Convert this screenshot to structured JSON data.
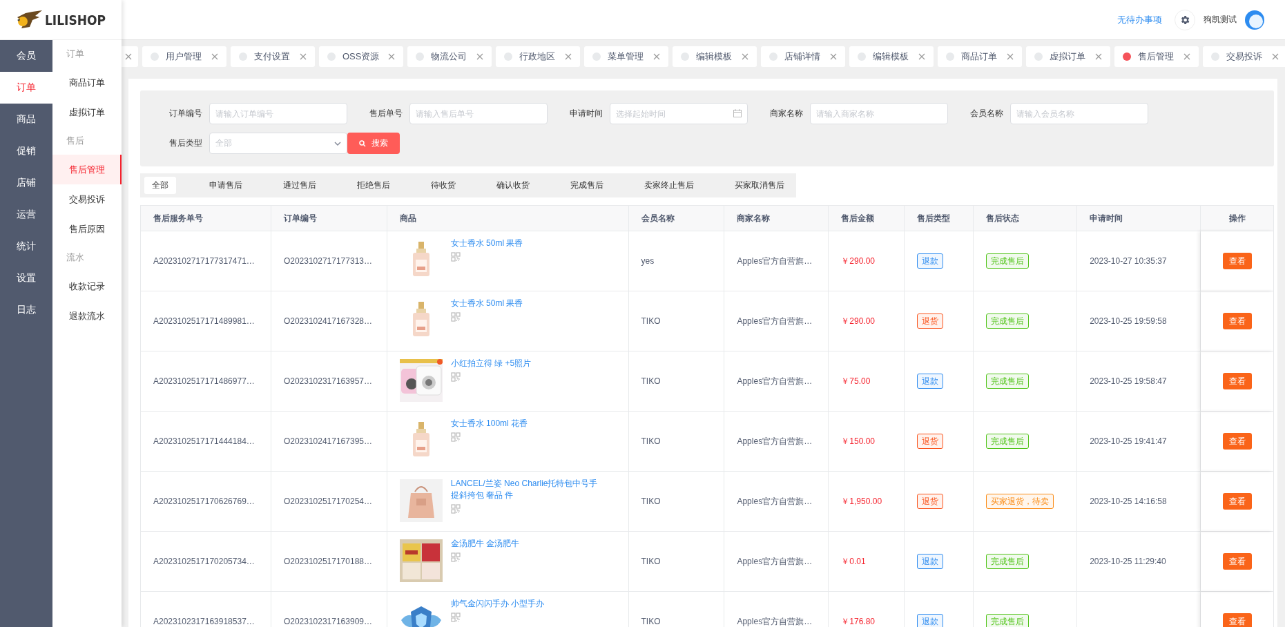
{
  "logo": {
    "text": "LILISHOP"
  },
  "header": {
    "todo": "无待办事项",
    "user": "狗凯测试"
  },
  "nav": [
    {
      "label": "会员",
      "selected": false
    },
    {
      "label": "订单",
      "selected": true
    },
    {
      "label": "商品",
      "selected": false
    },
    {
      "label": "促销",
      "selected": false
    },
    {
      "label": "店铺",
      "selected": false
    },
    {
      "label": "运营",
      "selected": false
    },
    {
      "label": "统计",
      "selected": false
    },
    {
      "label": "设置",
      "selected": false
    },
    {
      "label": "日志",
      "selected": false
    }
  ],
  "submenu": [
    {
      "kind": "group",
      "label": "订单"
    },
    {
      "kind": "item",
      "label": "商品订单",
      "selected": false
    },
    {
      "kind": "item",
      "label": "虚拟订单",
      "selected": false
    },
    {
      "kind": "group",
      "label": "售后"
    },
    {
      "kind": "item",
      "label": "售后管理",
      "selected": true
    },
    {
      "kind": "item",
      "label": "交易投诉",
      "selected": false
    },
    {
      "kind": "item",
      "label": "售后原因",
      "selected": false
    },
    {
      "kind": "group",
      "label": "流水"
    },
    {
      "kind": "item",
      "label": "收款记录",
      "selected": false
    },
    {
      "kind": "item",
      "label": "退款流水",
      "selected": false
    }
  ],
  "page_tabs": [
    {
      "kind": "cut"
    },
    {
      "kind": "tab",
      "label": "用户管理",
      "selected": false
    },
    {
      "kind": "tab",
      "label": "支付设置",
      "selected": false
    },
    {
      "kind": "tab",
      "label": "OSS资源",
      "selected": false
    },
    {
      "kind": "tab",
      "label": "物流公司",
      "selected": false
    },
    {
      "kind": "tab",
      "label": "行政地区",
      "selected": false
    },
    {
      "kind": "tab",
      "label": "菜单管理",
      "selected": false
    },
    {
      "kind": "tab",
      "label": "编辑模板",
      "selected": false
    },
    {
      "kind": "tab",
      "label": "店铺详情",
      "selected": false
    },
    {
      "kind": "tab",
      "label": "编辑模板",
      "selected": false
    },
    {
      "kind": "tab",
      "label": "商品订单",
      "selected": false
    },
    {
      "kind": "tab",
      "label": "虚拟订单",
      "selected": false
    },
    {
      "kind": "tab",
      "label": "售后管理",
      "selected": true
    },
    {
      "kind": "tab",
      "label": "交易投诉",
      "selected": false
    }
  ],
  "filters": [
    {
      "kind": "input",
      "label": "订单编号",
      "placeholder": "请输入订单编号"
    },
    {
      "kind": "input",
      "label": "售后单号",
      "placeholder": "请输入售后单号"
    },
    {
      "kind": "date",
      "label": "申请时间",
      "placeholder": "选择起始时间"
    },
    {
      "kind": "input",
      "label": "商家名称",
      "placeholder": "请输入商家名称"
    },
    {
      "kind": "input",
      "label": "会员名称",
      "placeholder": "请输入会员名称"
    },
    {
      "kind": "select",
      "label": "售后类型",
      "value": "全部"
    }
  ],
  "search_button": "搜索",
  "status_tabs": [
    {
      "label": "全部",
      "selected": true
    },
    {
      "label": "申请售后",
      "selected": false
    },
    {
      "label": "通过售后",
      "selected": false
    },
    {
      "label": "拒绝售后",
      "selected": false
    },
    {
      "label": "待收货",
      "selected": false
    },
    {
      "label": "确认收货",
      "selected": false
    },
    {
      "label": "完成售后",
      "selected": false
    },
    {
      "label": "卖家终止售后",
      "selected": false
    },
    {
      "label": "买家取消售后",
      "selected": false
    }
  ],
  "table": {
    "columns": [
      "售后服务单号",
      "订单编号",
      "商品",
      "会员名称",
      "商家名称",
      "售后金额",
      "售后类型",
      "售后状态",
      "申请时间",
      "操作"
    ],
    "rows": [
      {
        "service_no": "A2023102717177317471…",
        "order_no": "O2023102717177313…",
        "product": {
          "name": "女士香水 50ml 果香"
        },
        "member": "yes",
        "merchant": "Apples官方自营旗…",
        "amount": "￥290.00",
        "type": {
          "text": "退款",
          "color": "#2d8cf0"
        },
        "status": {
          "text": "完成售后",
          "color": "#52c41a"
        },
        "time": "2023-10-27 10:35:37",
        "action": "查看"
      },
      {
        "service_no": "A2023102517171489981…",
        "order_no": "O2023102417167328…",
        "product": {
          "name": "女士香水 50ml 果香"
        },
        "member": "TIKO",
        "merchant": "Apples官方自营旗…",
        "amount": "￥290.00",
        "type": {
          "text": "退货",
          "color": "#fa541c"
        },
        "status": {
          "text": "完成售后",
          "color": "#52c41a"
        },
        "time": "2023-10-25 19:59:58",
        "action": "查看"
      },
      {
        "service_no": "A2023102517171486977…",
        "order_no": "O2023102317163957…",
        "product": {
          "name": "小红拍立得 绿 +5照片"
        },
        "member": "TIKO",
        "merchant": "Apples官方自营旗…",
        "amount": "￥75.00",
        "type": {
          "text": "退款",
          "color": "#2d8cf0"
        },
        "status": {
          "text": "完成售后",
          "color": "#52c41a"
        },
        "time": "2023-10-25 19:58:47",
        "action": "查看"
      },
      {
        "service_no": "A2023102517171444184…",
        "order_no": "O2023102417167395…",
        "product": {
          "name": "女士香水 100ml 花香"
        },
        "member": "TIKO",
        "merchant": "Apples官方自营旗…",
        "amount": "￥150.00",
        "type": {
          "text": "退货",
          "color": "#fa541c"
        },
        "status": {
          "text": "完成售后",
          "color": "#52c41a"
        },
        "time": "2023-10-25 19:41:47",
        "action": "查看"
      },
      {
        "service_no": "A2023102517170626769…",
        "order_no": "O2023102517170254…",
        "product": {
          "name": "LANCEL/兰姿 Neo Charlie托特包中号手提斜挎包 奢品 件"
        },
        "member": "TIKO",
        "merchant": "Apples官方自营旗…",
        "amount": "￥1,950.00",
        "type": {
          "text": "退货",
          "color": "#fa541c"
        },
        "status": {
          "text": "买家退货，待卖",
          "color": "#fa8c16"
        },
        "time": "2023-10-25 14:16:58",
        "action": "查看"
      },
      {
        "service_no": "A2023102517170205734…",
        "order_no": "O2023102517170188…",
        "product": {
          "name": "金汤肥牛 金汤肥牛"
        },
        "member": "TIKO",
        "merchant": "Apples官方自营旗…",
        "amount": "￥0.01",
        "type": {
          "text": "退款",
          "color": "#2d8cf0"
        },
        "status": {
          "text": "完成售后",
          "color": "#52c41a"
        },
        "time": "2023-10-25 11:29:40",
        "action": "查看"
      },
      {
        "service_no": "A2023102317163918537…",
        "order_no": "O2023102317163909…",
        "product": {
          "name": "帅气金闪闪手办 小型手办"
        },
        "member": "TIKO",
        "merchant": "Apples官方自营旗…",
        "amount": "￥176.80",
        "type": {
          "text": "退款",
          "color": "#2d8cf0"
        },
        "status": {
          "text": "完成售后",
          "color": "#52c41a"
        },
        "action": "查看"
      }
    ]
  }
}
